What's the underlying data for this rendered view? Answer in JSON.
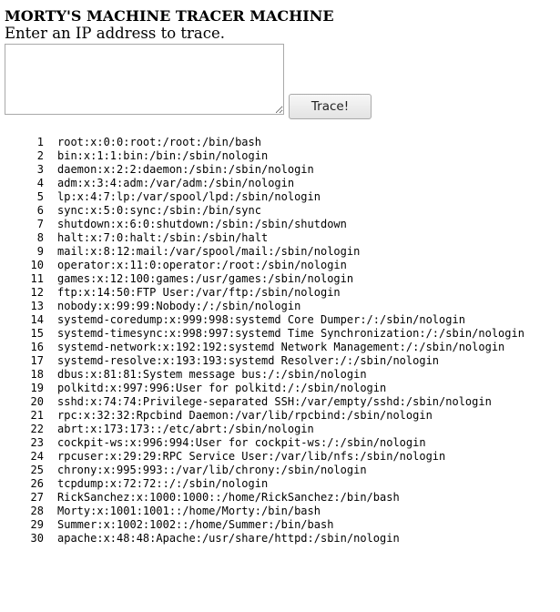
{
  "page": {
    "title": "MORTY'S MACHINE TRACER MACHINE",
    "prompt": "Enter an IP address to trace.",
    "input_value": "",
    "button_label": "Trace!"
  },
  "output": {
    "lines": [
      {
        "num": "1",
        "text": "root:x:0:0:root:/root:/bin/bash"
      },
      {
        "num": "2",
        "text": "bin:x:1:1:bin:/bin:/sbin/nologin"
      },
      {
        "num": "3",
        "text": "daemon:x:2:2:daemon:/sbin:/sbin/nologin"
      },
      {
        "num": "4",
        "text": "adm:x:3:4:adm:/var/adm:/sbin/nologin"
      },
      {
        "num": "5",
        "text": "lp:x:4:7:lp:/var/spool/lpd:/sbin/nologin"
      },
      {
        "num": "6",
        "text": "sync:x:5:0:sync:/sbin:/bin/sync"
      },
      {
        "num": "7",
        "text": "shutdown:x:6:0:shutdown:/sbin:/sbin/shutdown"
      },
      {
        "num": "8",
        "text": "halt:x:7:0:halt:/sbin:/sbin/halt"
      },
      {
        "num": "9",
        "text": "mail:x:8:12:mail:/var/spool/mail:/sbin/nologin"
      },
      {
        "num": "10",
        "text": "operator:x:11:0:operator:/root:/sbin/nologin"
      },
      {
        "num": "11",
        "text": "games:x:12:100:games:/usr/games:/sbin/nologin"
      },
      {
        "num": "12",
        "text": "ftp:x:14:50:FTP User:/var/ftp:/sbin/nologin"
      },
      {
        "num": "13",
        "text": "nobody:x:99:99:Nobody:/:/sbin/nologin"
      },
      {
        "num": "14",
        "text": "systemd-coredump:x:999:998:systemd Core Dumper:/:/sbin/nologin"
      },
      {
        "num": "15",
        "text": "systemd-timesync:x:998:997:systemd Time Synchronization:/:/sbin/nologin"
      },
      {
        "num": "16",
        "text": "systemd-network:x:192:192:systemd Network Management:/:/sbin/nologin"
      },
      {
        "num": "17",
        "text": "systemd-resolve:x:193:193:systemd Resolver:/:/sbin/nologin"
      },
      {
        "num": "18",
        "text": "dbus:x:81:81:System message bus:/:/sbin/nologin"
      },
      {
        "num": "19",
        "text": "polkitd:x:997:996:User for polkitd:/:/sbin/nologin"
      },
      {
        "num": "20",
        "text": "sshd:x:74:74:Privilege-separated SSH:/var/empty/sshd:/sbin/nologin"
      },
      {
        "num": "21",
        "text": "rpc:x:32:32:Rpcbind Daemon:/var/lib/rpcbind:/sbin/nologin"
      },
      {
        "num": "22",
        "text": "abrt:x:173:173::/etc/abrt:/sbin/nologin"
      },
      {
        "num": "23",
        "text": "cockpit-ws:x:996:994:User for cockpit-ws:/:/sbin/nologin"
      },
      {
        "num": "24",
        "text": "rpcuser:x:29:29:RPC Service User:/var/lib/nfs:/sbin/nologin"
      },
      {
        "num": "25",
        "text": "chrony:x:995:993::/var/lib/chrony:/sbin/nologin"
      },
      {
        "num": "26",
        "text": "tcpdump:x:72:72::/:/sbin/nologin"
      },
      {
        "num": "27",
        "text": "RickSanchez:x:1000:1000::/home/RickSanchez:/bin/bash"
      },
      {
        "num": "28",
        "text": "Morty:x:1001:1001::/home/Morty:/bin/bash"
      },
      {
        "num": "29",
        "text": "Summer:x:1002:1002::/home/Summer:/bin/bash"
      },
      {
        "num": "30",
        "text": "apache:x:48:48:Apache:/usr/share/httpd:/sbin/nologin"
      }
    ]
  }
}
